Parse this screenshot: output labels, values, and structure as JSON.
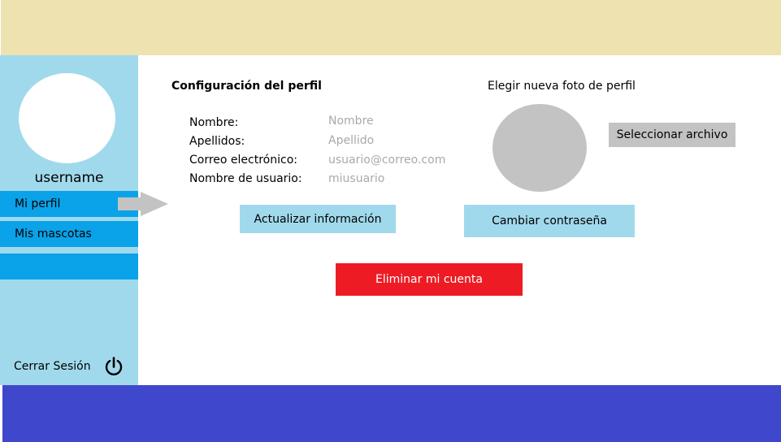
{
  "sidebar": {
    "username": "username",
    "items": [
      {
        "label": "Mi perfil"
      },
      {
        "label": "Mis mascotas"
      },
      {
        "label": ""
      }
    ],
    "logout_label": "Cerrar Sesión",
    "logout_icon": "power-icon"
  },
  "profile": {
    "title": "Configuración del perfil",
    "fields": [
      {
        "label": "Nombre:",
        "value": "Nombre"
      },
      {
        "label": "Apellidos:",
        "value": "Apellido"
      },
      {
        "label": "Correo electrónico:",
        "value": "usuario@correo.com"
      },
      {
        "label": "Nombre de usuario:",
        "value": "miusuario"
      }
    ],
    "update_button": "Actualizar información",
    "password_button": "Cambiar contraseña",
    "delete_button": "Eliminar mi cuenta"
  },
  "photo": {
    "title": "Elegir nueva foto de perfil",
    "select_button": "Seleccionar archivo"
  },
  "colors": {
    "header": "#efe2b1",
    "sidebar": "#a1d9ec",
    "nav_item": "#0aa2e8",
    "footer": "#3f48cc",
    "delete": "#ed1c24",
    "placeholder_text": "#a9a9a9"
  }
}
